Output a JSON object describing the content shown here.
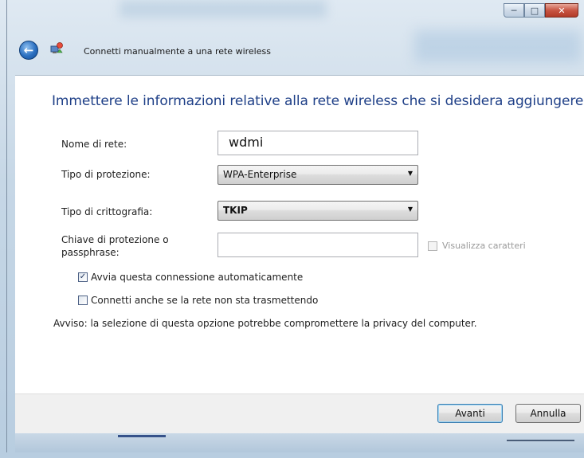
{
  "window": {
    "title": "Connetti manualmente a una rete wireless",
    "controls": {
      "minimize_icon": "minimize-icon",
      "maximize_icon": "maximize-icon",
      "close_icon": "close-icon"
    }
  },
  "main": {
    "heading": "Immettere le informazioni relative alla rete wireless che si desidera aggiungere",
    "network_name": {
      "label": "Nome di rete:",
      "value": "wdmi"
    },
    "security_type": {
      "label": "Tipo di protezione:",
      "value": "WPA-Enterprise"
    },
    "encryption_type": {
      "label": "Tipo di crittografia:",
      "value": "TKIP"
    },
    "security_key": {
      "label_line1": "Chiave di protezione o",
      "label_line2": "passphrase:",
      "value": "",
      "show_chars_label": "Visualizza caratteri",
      "show_chars_checked": false
    },
    "auto_start": {
      "label": "Avvia questa connessione automaticamente",
      "checked": true
    },
    "connect_hidden": {
      "label": "Connetti anche se la rete non sta trasmettendo",
      "checked": false
    },
    "warning": "Avviso: la selezione di questa opzione potrebbe compromettere la privacy del computer."
  },
  "footer": {
    "next_label": "Avanti",
    "cancel_label": "Annulla"
  },
  "colors": {
    "heading": "#1e3f87",
    "close_button": "#c85543",
    "frame": "#c6d7e6"
  }
}
